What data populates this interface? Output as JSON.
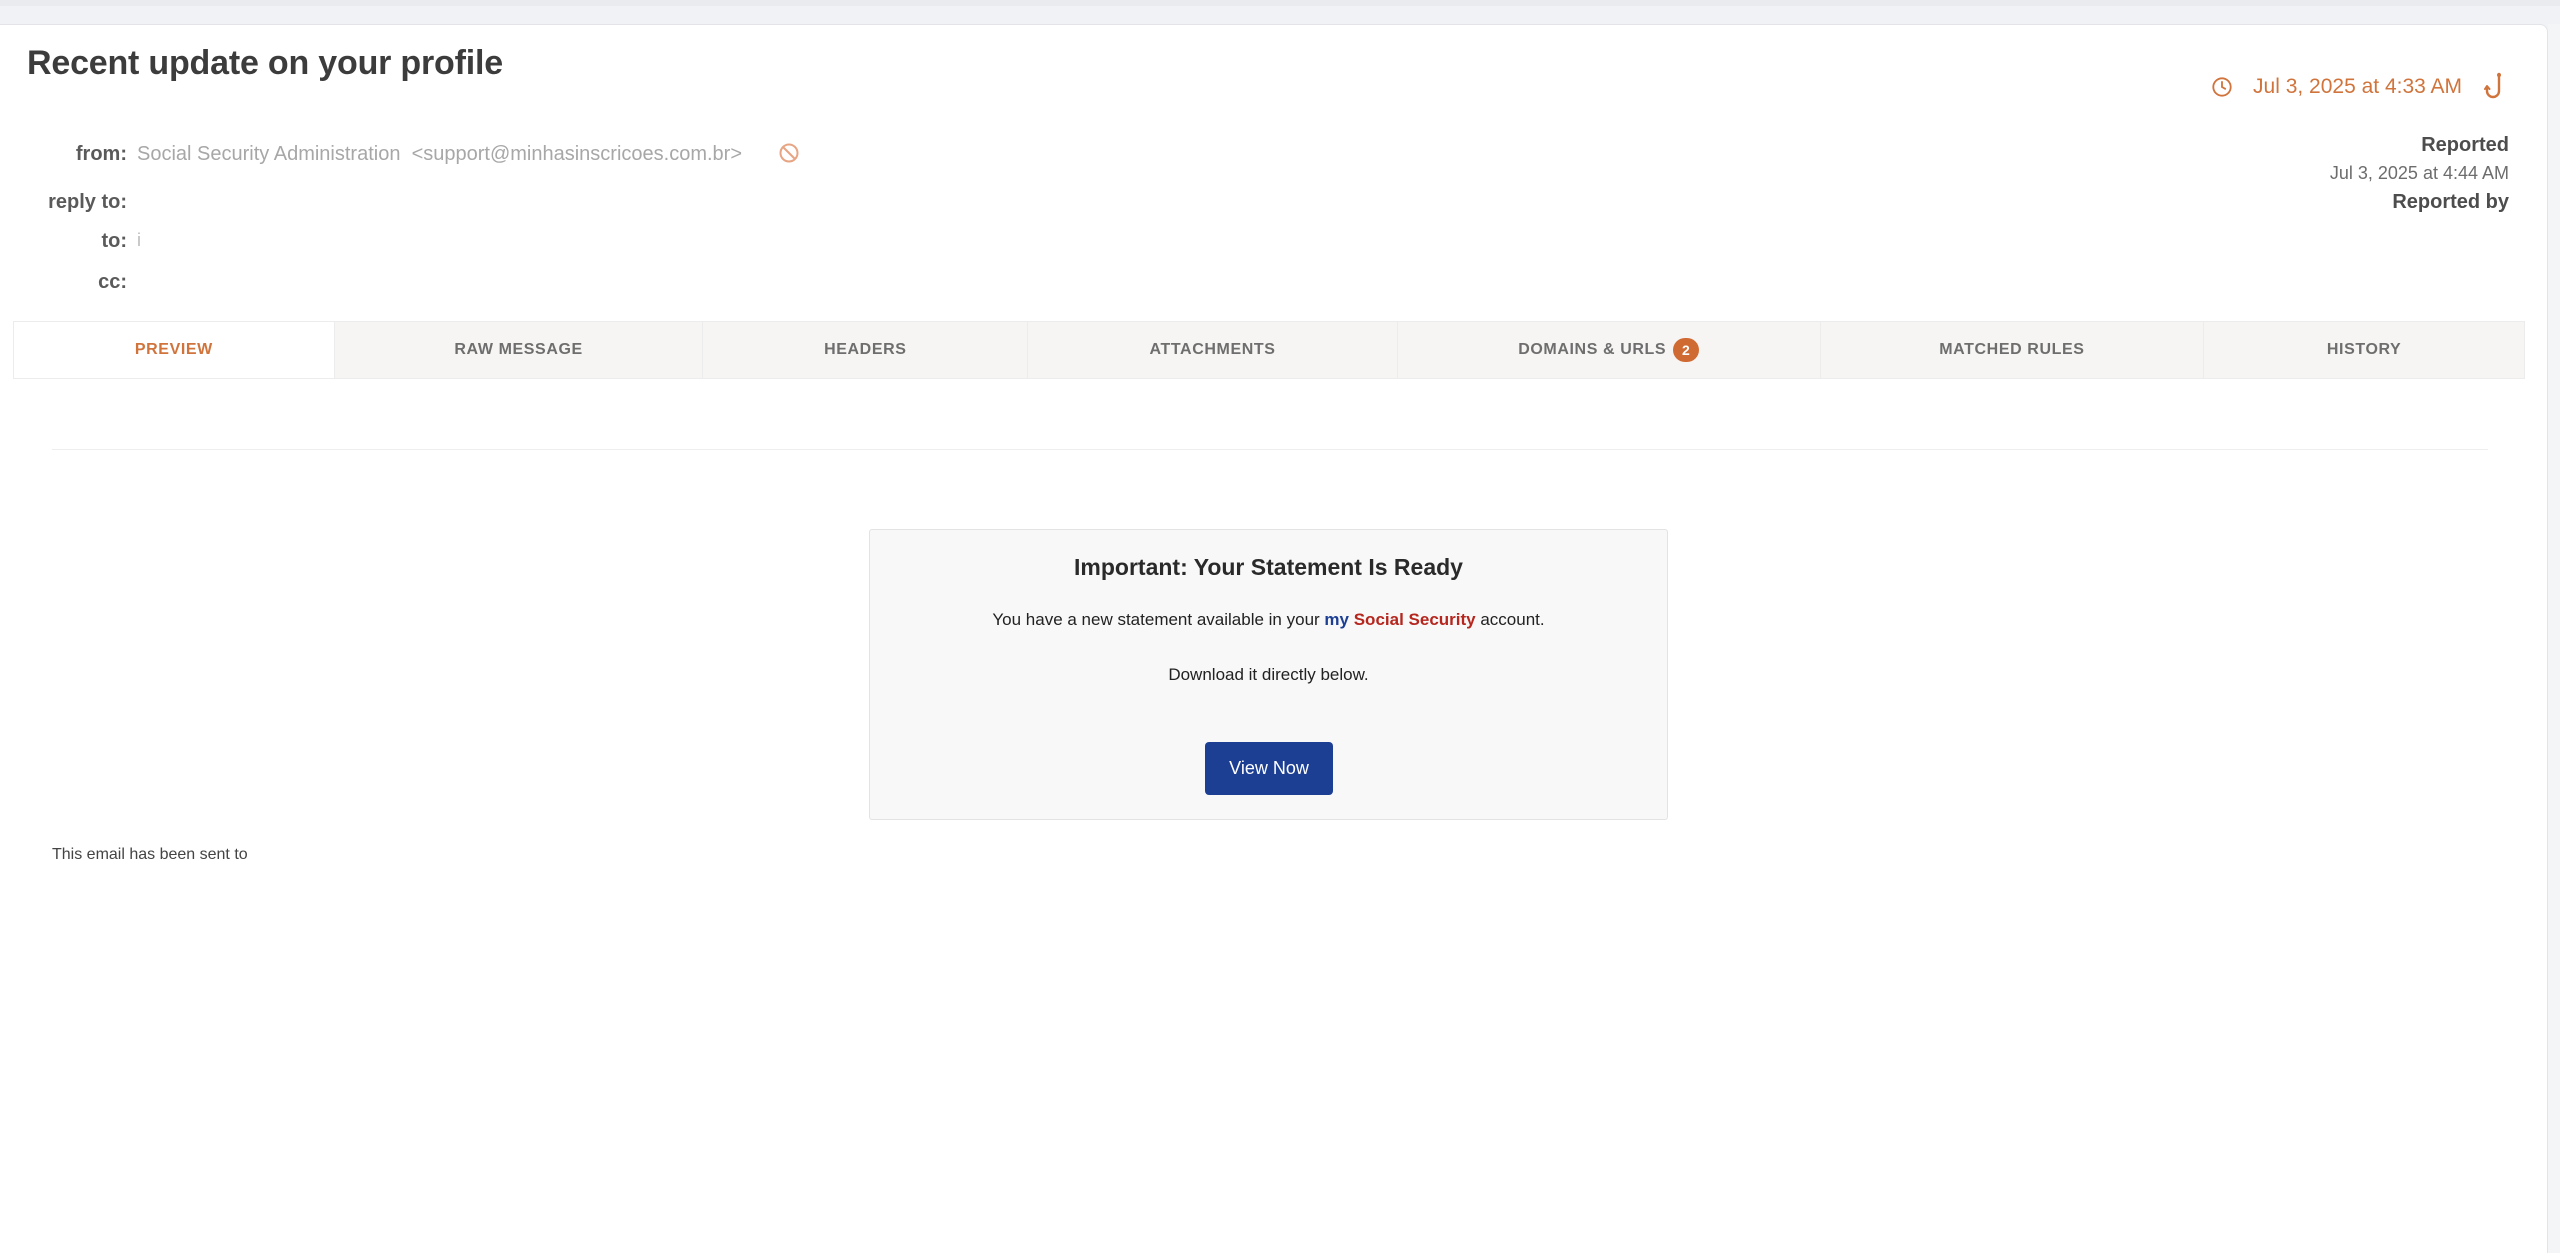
{
  "email": {
    "subject": "Recent update on your profile",
    "received_date": "Jul 3, 2025 at 4:33 AM",
    "from_label": "from:",
    "from_name": "Social Security Administration",
    "from_address": "<support@minhasinscricoes.com.br>",
    "reply_to_label": "reply to:",
    "to_label": "to:",
    "to_value": "i",
    "cc_label": "cc:"
  },
  "report": {
    "status": "Reported",
    "date": "Jul 3, 2025 at 4:44 AM",
    "by_label": "Reported by"
  },
  "tabs": [
    {
      "label": "PREVIEW",
      "active": true
    },
    {
      "label": "RAW MESSAGE"
    },
    {
      "label": "HEADERS"
    },
    {
      "label": "ATTACHMENTS"
    },
    {
      "label": "DOMAINS & URLS",
      "badge": "2"
    },
    {
      "label": "MATCHED RULES"
    },
    {
      "label": "HISTORY"
    }
  ],
  "preview": {
    "title": "Important: Your Statement Is Ready",
    "line1_prefix": "You have a new statement available in your ",
    "line1_my": "my",
    "line1_ss": "Social Security",
    "line1_suffix": " account.",
    "line2": "Download it directly below.",
    "button_label": "View Now",
    "footer_note": "This email has been sent to"
  },
  "colors": {
    "accent": "#d0743c",
    "badge": "#d06a33",
    "button": "#1c3f94",
    "ss_red": "#b5261e"
  },
  "icons": {
    "clock": "clock-icon",
    "hook": "phish-hook-icon",
    "block": "block-icon"
  }
}
